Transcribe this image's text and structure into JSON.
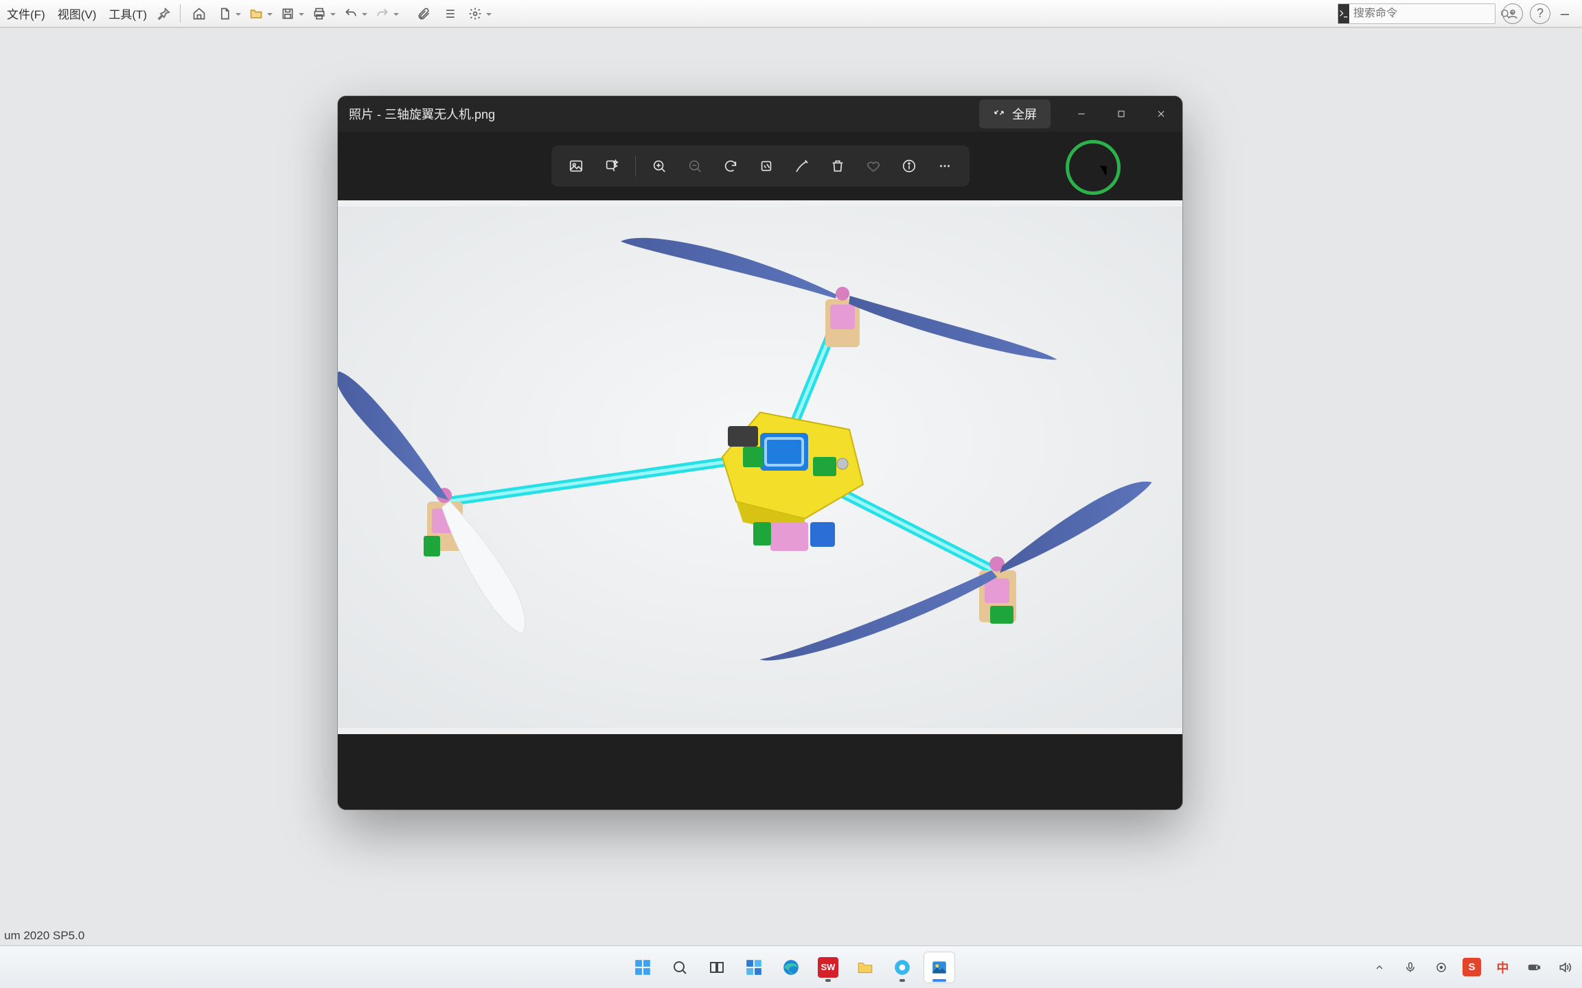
{
  "bg_app": {
    "menus": {
      "file": "文件(F)",
      "view": "视图(V)",
      "tools": "工具(T)"
    },
    "search_placeholder": "搜索命令",
    "status_line": "um 2020 SP5.0"
  },
  "photos": {
    "title": "照片 - 三轴旋翼无人机.png",
    "fullscreen_label": "全屏"
  },
  "taskbar_icons": {
    "start": "开始",
    "search": "搜索",
    "taskview": "任务视图",
    "widgets": "小组件",
    "edge": "Edge",
    "solidworks": "SW",
    "explorer": "文件资源管理器",
    "browser": "浏览器",
    "photos": "照片"
  }
}
